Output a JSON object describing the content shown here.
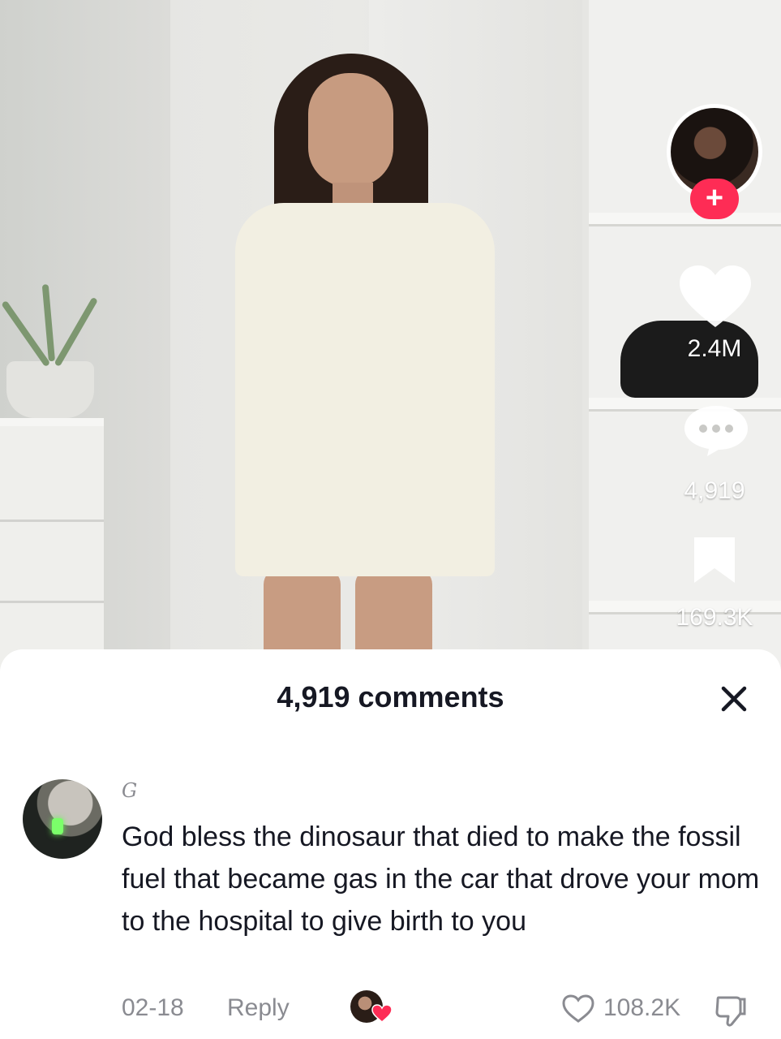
{
  "video": {
    "creator": {
      "follow_label": "+"
    },
    "actions": {
      "likes": "2.4M",
      "comments": "4,919",
      "saves": "169.3K"
    }
  },
  "comments_sheet": {
    "title": "4,919 comments",
    "close_label": "×",
    "comment": {
      "username": "G",
      "text": "God bless the dinosaur that died to make the fossil fuel that became gas in the car that drove your mom to the hospital to give birth to you",
      "date": "02-18",
      "reply_label": "Reply",
      "likes": "108.2K"
    }
  },
  "colors": {
    "accent": "#fe2c55",
    "text_primary": "#161823",
    "text_secondary": "#8a8b91"
  }
}
